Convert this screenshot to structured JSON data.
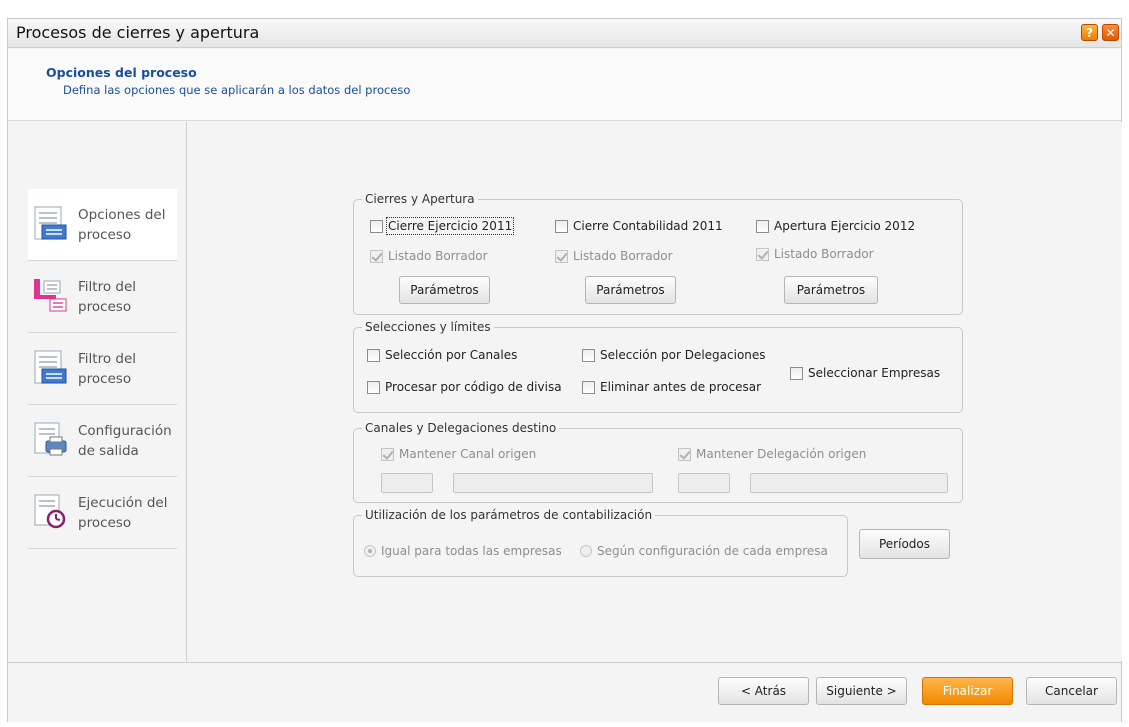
{
  "window": {
    "title": "Procesos de cierres y apertura"
  },
  "header": {
    "title": "Opciones del proceso",
    "subtitle": "Defina las opciones que se aplicarán a los datos del proceso"
  },
  "sidebar": {
    "items": [
      {
        "label": "Opciones del proceso",
        "icon": "list-form-icon",
        "active": true
      },
      {
        "label": "Filtro del proceso",
        "icon": "filter-tree-icon",
        "active": false
      },
      {
        "label": "Filtro del proceso",
        "icon": "list-form-icon",
        "active": false
      },
      {
        "label": "Configuración de salida",
        "icon": "printer-icon",
        "active": false
      },
      {
        "label": "Ejecución del proceso",
        "icon": "alarm-clock-icon",
        "active": false
      }
    ]
  },
  "cierres": {
    "legend": "Cierres y Apertura",
    "col1": {
      "label": "Cierre Ejercicio 2011",
      "listado": "Listado Borrador",
      "params": "Parámetros"
    },
    "col2": {
      "label": "Cierre Contabilidad 2011",
      "listado": "Listado Borrador",
      "params": "Parámetros"
    },
    "col3": {
      "label": "Apertura Ejercicio 2012",
      "listado": "Listado Borrador",
      "params": "Parámetros"
    }
  },
  "selecciones": {
    "legend": "Selecciones y  límites",
    "canales": "Selección por Canales",
    "delegaciones": "Selección por Delegaciones",
    "divisa": "Procesar por código de divisa",
    "eliminar": "Eliminar antes de procesar",
    "empresas": "Seleccionar Empresas"
  },
  "destino": {
    "legend": "Canales y Delegaciones destino",
    "canal": "Mantener Canal origen",
    "delegacion": "Mantener Delegación origen"
  },
  "contabilizacion": {
    "legend": "Utilización de los parámetros de contabilización",
    "igual": "Igual para todas las empresas",
    "segun": "Según configuración de cada empresa",
    "periodos": "Períodos"
  },
  "footer": {
    "atras": "< Atrás",
    "siguiente": "Siguiente >",
    "finalizar": "Finalizar",
    "cancelar": "Cancelar"
  },
  "colors": {
    "accent": "#1a4d9c",
    "primary_button": "#f08a00"
  }
}
